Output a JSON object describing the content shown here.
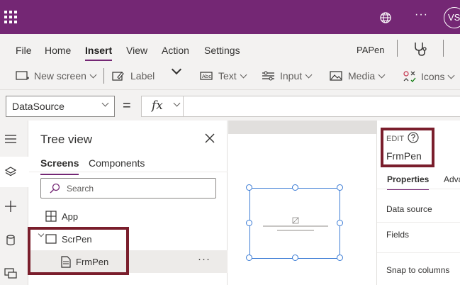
{
  "topbar": {
    "avatar_initials": "VS",
    "more_label": "···",
    "bg_color": "#742774"
  },
  "menu": {
    "items": [
      "File",
      "Home",
      "Insert",
      "View",
      "Action",
      "Settings"
    ],
    "active": "Insert",
    "app_name": "PAPen"
  },
  "toolbar": {
    "new_screen": "New screen",
    "label": "Label",
    "text": "Text",
    "input": "Input",
    "media": "Media",
    "icons": "Icons"
  },
  "formula": {
    "property": "DataSource",
    "equals": "=",
    "fx": "fx"
  },
  "tree": {
    "title": "Tree view",
    "tabs": [
      "Screens",
      "Components"
    ],
    "active_tab": "Screens",
    "search_placeholder": "Search",
    "items": [
      {
        "label": "App"
      },
      {
        "label": "ScrPen"
      },
      {
        "label": "FrmPen"
      }
    ],
    "row_more": "···"
  },
  "right_panel": {
    "edit_label": "EDIT",
    "control_name": "FrmPen",
    "tabs": [
      "Properties",
      "Adva"
    ],
    "active_tab": "Properties",
    "properties": [
      "Data source",
      "Fields",
      "Snap to columns"
    ]
  },
  "colors": {
    "accent": "#742774",
    "highlight": "#7a1e2c",
    "selection": "#3a7bd5"
  }
}
